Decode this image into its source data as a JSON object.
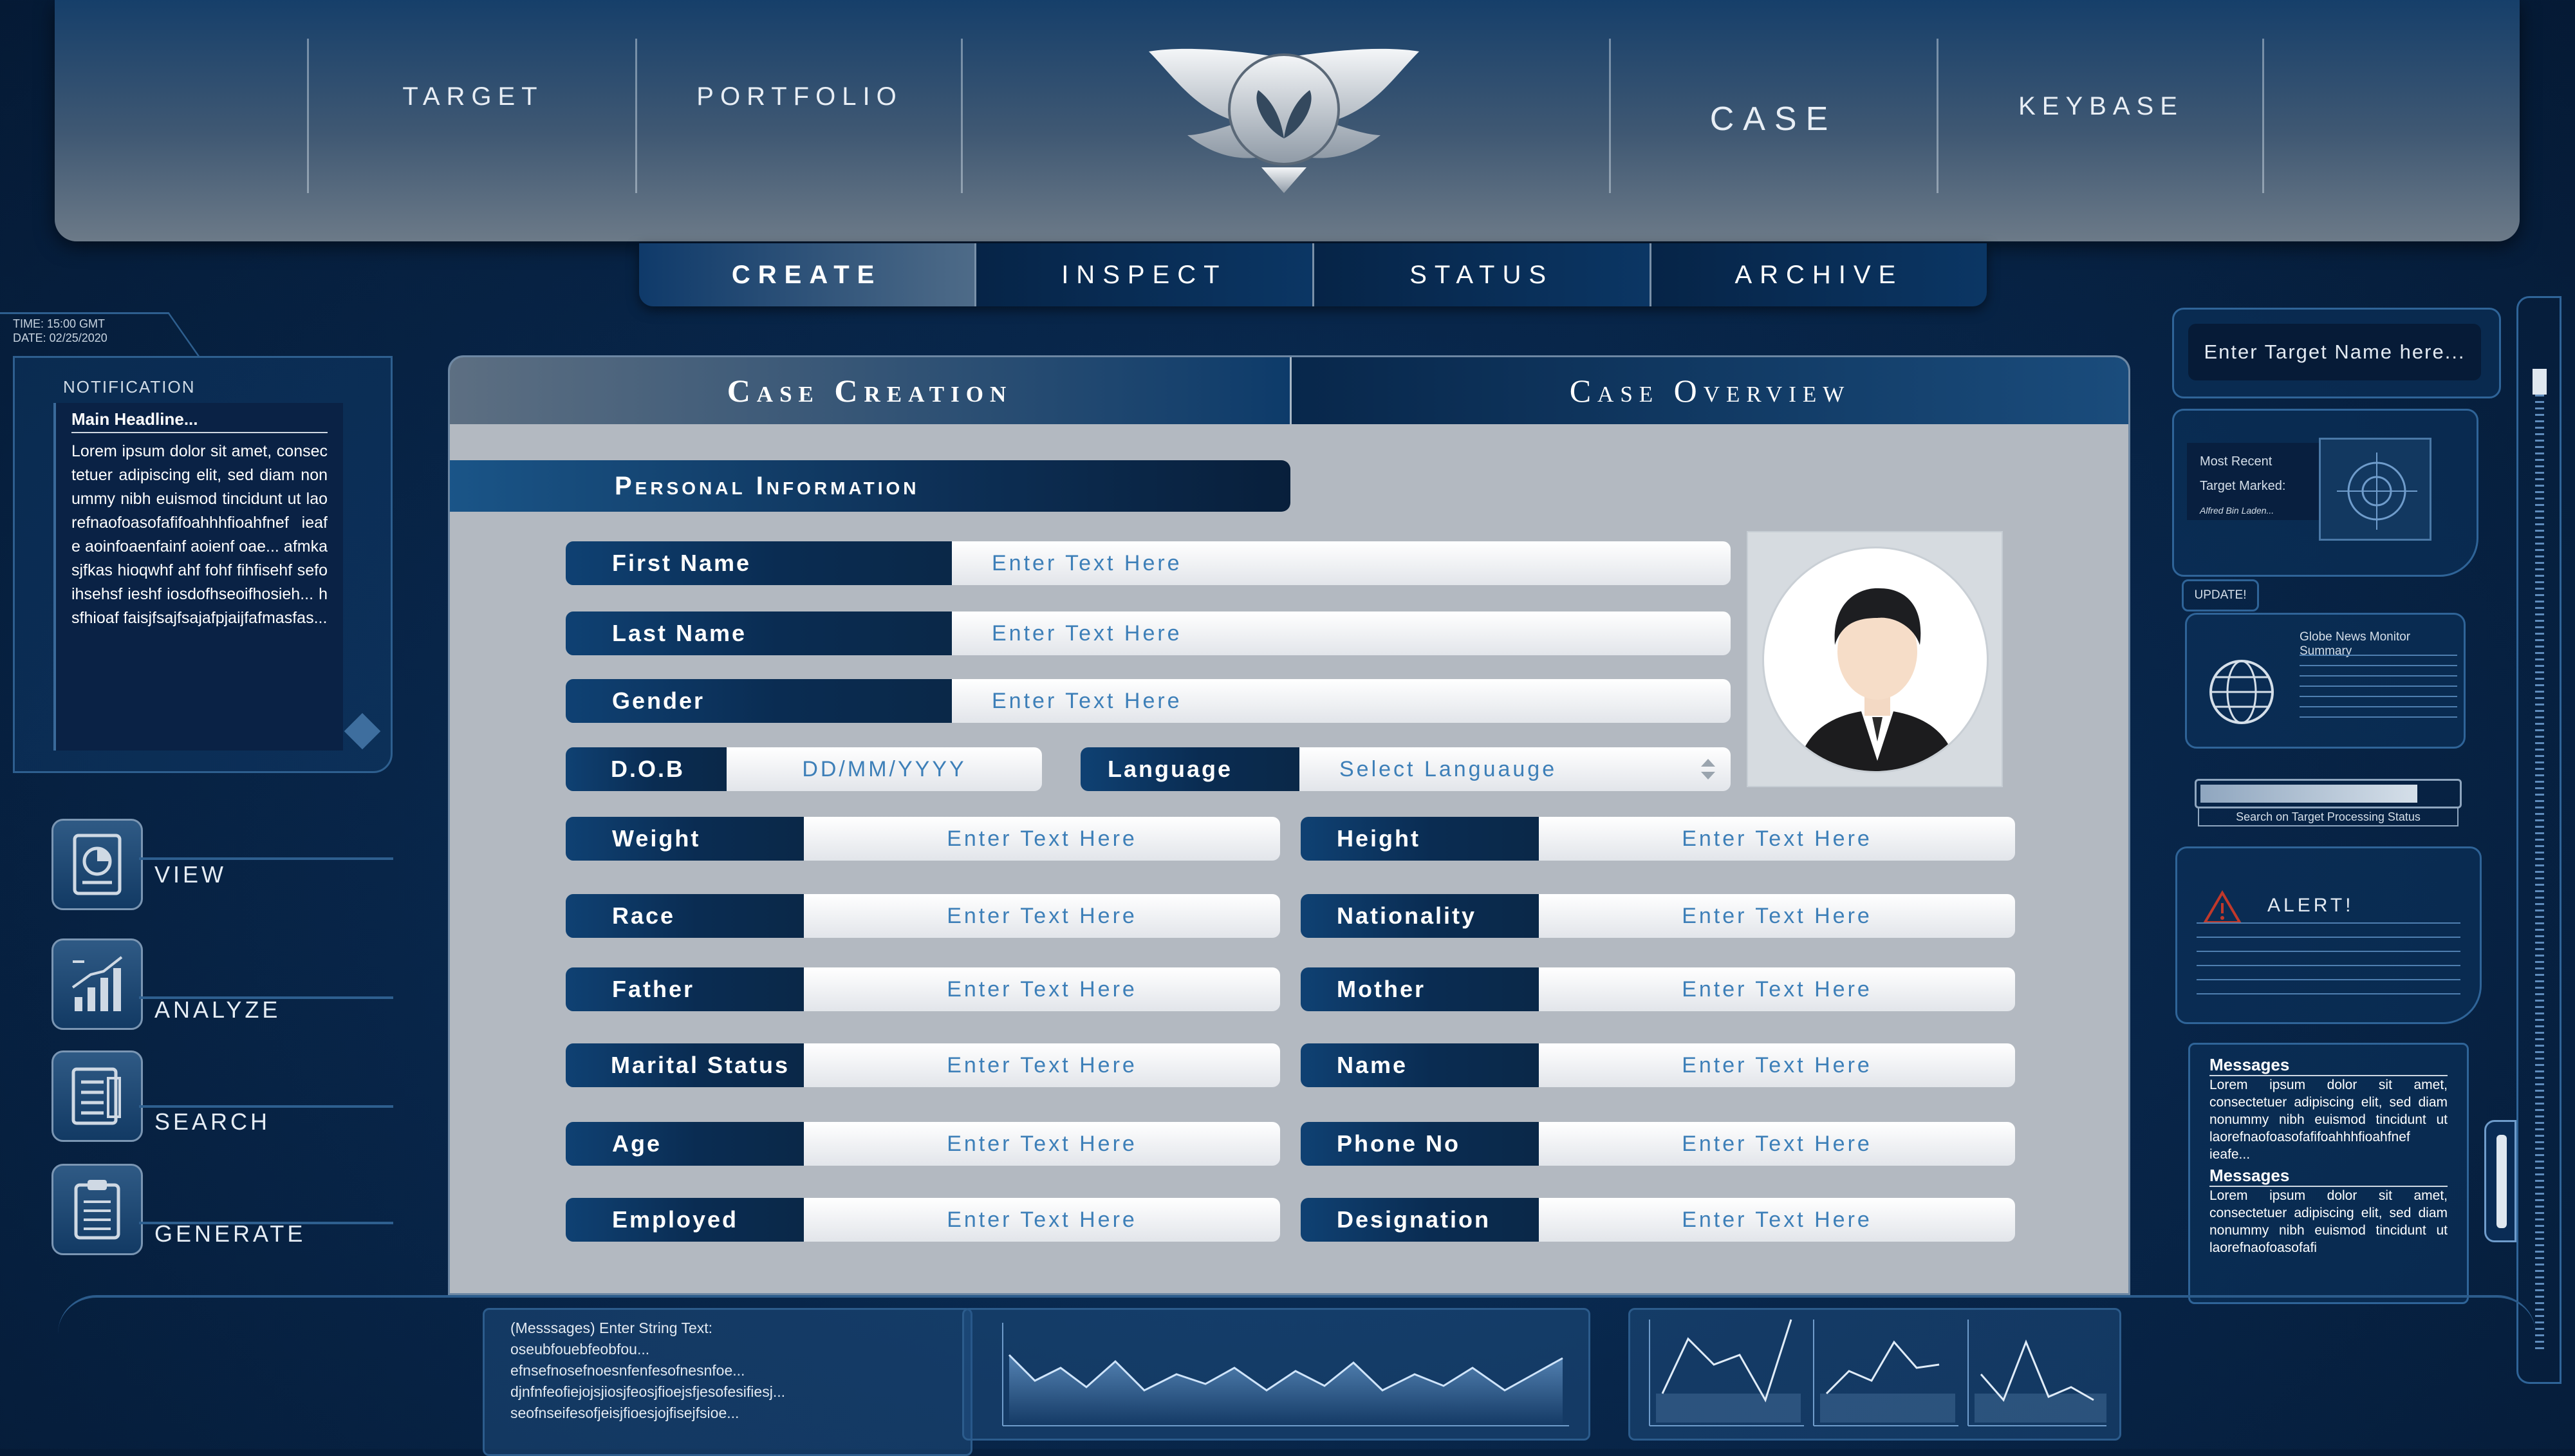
{
  "nav": {
    "items": [
      "TARGET",
      "PORTFOLIO",
      "CASE",
      "KEYBASE"
    ]
  },
  "subnav": {
    "tabs": [
      "CREATE",
      "INSPECT",
      "STATUS",
      "ARCHIVE"
    ]
  },
  "case_tabs": [
    "Case Creation",
    "Case Overview"
  ],
  "personal_info": {
    "header": "Personal Information",
    "placeholder": "Enter Text Here",
    "first_name": "First Name",
    "last_name": "Last Name",
    "gender": "Gender",
    "dob": "D.O.B",
    "dob_placeholder": "DD/MM/YYYY",
    "language": "Language",
    "language_placeholder": "Select Languauge",
    "left_fields": [
      "Weight",
      "Race",
      "Father",
      "Marital Status",
      "Age",
      "Employed"
    ],
    "right_fields": [
      "Height",
      "Nationality",
      "Mother",
      "Name",
      "Phone No",
      "Designation"
    ]
  },
  "sidebar": {
    "time": "TIME: 15:00 GMT",
    "date": "DATE: 02/25/2020",
    "notification_title": "NOTIFICATION",
    "headline": "Main Headline...",
    "body": "Lorem ipsum dolor sit amet, consectetuer adipiscing elit, sed diam nonummy nibh euismod tincidunt ut laorefnaofoasofafifoahhhfioahfnef ieafe aoinfoaenfainf aoienf oae... afmkasjfkas hioqwhf ahf fohf fihfisehf sefoihsehsf ieshf iosdofhseoifhosieh... hsfhioaf faisjfsajfsajafpjaijfafmasfas...",
    "buttons": [
      "VIEW",
      "ANALYZE",
      "SEARCH",
      "GENERATE"
    ]
  },
  "right": {
    "search_placeholder": "Enter Target Name here...",
    "most_recent": "Most Recent",
    "target_marked": "Target Marked:",
    "target_name": "Alfred Bin Laden...",
    "update": "UPDATE!",
    "globe_title": "Globe News Monitor Summary",
    "status_caption": "Search on Target Processing Status",
    "status_progress": 0.85,
    "alert": "ALERT!",
    "messages_title": "Messages",
    "messages_body": "Lorem ipsum dolor sit amet, consectetuer adipiscing elit, sed diam nonummy nibh euismod tincidunt ut laorefnaofoasofafifoahhhfioahfnef ieafe...",
    "messages_title_2": "Messages",
    "messages_body_2": "Lorem ipsum dolor sit amet, consectetuer adipiscing elit, sed diam nonummy nibh euismod tincidunt ut laorefnaofoasofafi"
  },
  "bottom": {
    "messages": [
      "(Messsages) Enter String Text:",
      "oseubfouebfeobfou...",
      "efnsefnosefnoesnfenfesofnesnfoe...",
      "djnfnfeofiejojsjiosjfeosjfioejsfjesofesifiesj...",
      "seofnseifesofjeisjfioesjojfisejfsioe..."
    ]
  },
  "colors": {
    "accent": "#0b3664",
    "field_text": "#3d7fb8",
    "panel": "#b3b9c1"
  }
}
